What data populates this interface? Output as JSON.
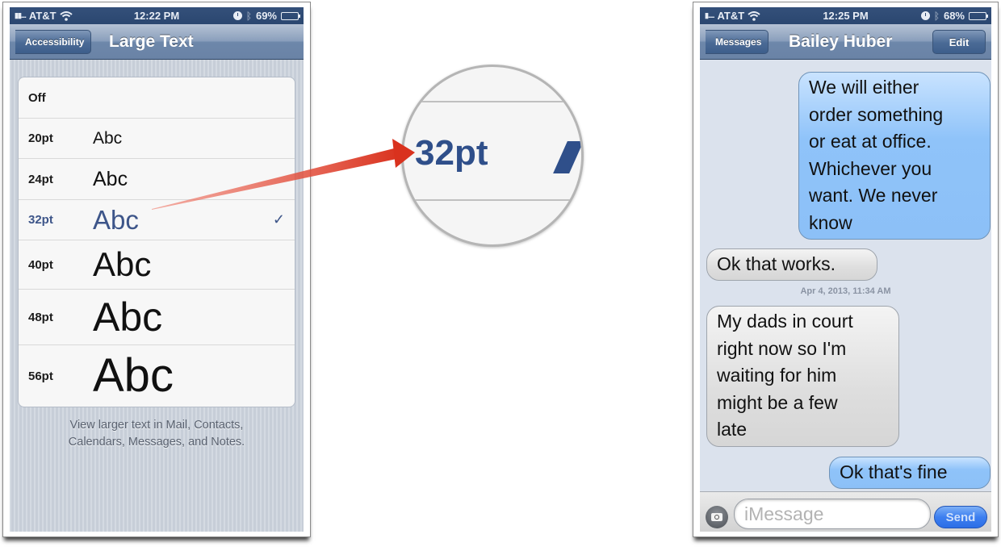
{
  "left_phone": {
    "status_bar": {
      "carrier": "AT&T",
      "time": "12:22 PM",
      "battery": "69%",
      "battery_level": 0.69
    },
    "nav": {
      "back_label": "Accessibility",
      "title": "Large Text"
    },
    "options": [
      {
        "label": "Off",
        "sample": "",
        "selected": false
      },
      {
        "label": "20pt",
        "sample": "Abc",
        "selected": false
      },
      {
        "label": "24pt",
        "sample": "Abc",
        "selected": false
      },
      {
        "label": "32pt",
        "sample": "Abc",
        "selected": true
      },
      {
        "label": "40pt",
        "sample": "Abc",
        "selected": false
      },
      {
        "label": "48pt",
        "sample": "Abc",
        "selected": false
      },
      {
        "label": "56pt",
        "sample": "Abc",
        "selected": false
      }
    ],
    "checkmark": "✓",
    "footnote_line1": "View larger text in Mail, Contacts,",
    "footnote_line2": "Calendars, Messages, and Notes."
  },
  "magnifier": {
    "label": "32pt"
  },
  "right_phone": {
    "status_bar": {
      "carrier": "AT&T",
      "time": "12:25 PM",
      "battery": "68%",
      "battery_level": 0.68
    },
    "nav": {
      "back_label": "Messages",
      "title": "Bailey Huber",
      "edit_label": "Edit"
    },
    "messages": [
      {
        "direction": "sent",
        "lines": [
          "We will either",
          "order something",
          "or eat at office.",
          "Whichever you",
          "want. We never",
          "know"
        ]
      },
      {
        "direction": "received",
        "lines": [
          "Ok that works."
        ]
      },
      {
        "direction": "received",
        "lines": [
          "My dads in court",
          "right now so I'm",
          "waiting for him",
          "might be a few",
          "late"
        ]
      },
      {
        "direction": "sent",
        "lines": [
          "Ok that's fine"
        ]
      }
    ],
    "timestamp": "Apr 4, 2013, 11:34 AM",
    "composer": {
      "placeholder": "iMessage",
      "value": "",
      "send_label": "Send"
    }
  },
  "colors": {
    "accent_blue": "#3d5589",
    "arrow_red": "#d9321e",
    "sent_bubble": "#8fc3f9",
    "received_bubble": "#dedede"
  }
}
